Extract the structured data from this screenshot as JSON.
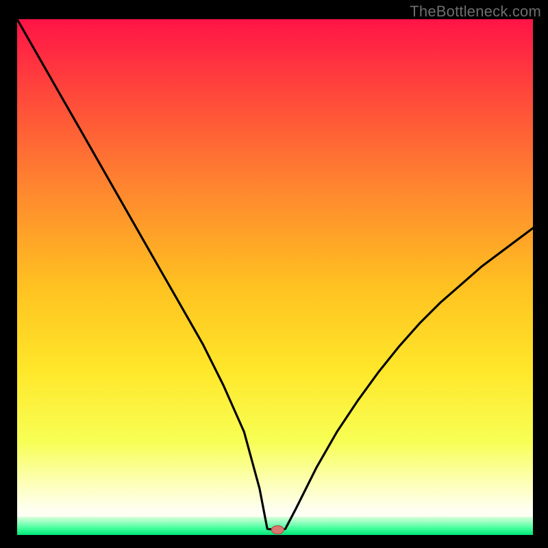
{
  "watermark": "TheBottleneck.com",
  "chart_data": {
    "type": "line",
    "title": "",
    "xlabel": "",
    "ylabel": "",
    "xlim": [
      0,
      100
    ],
    "ylim": [
      0,
      100
    ],
    "grid": false,
    "legend": false,
    "series": [
      {
        "name": "bottleneck-curve",
        "x": [
          0,
          4,
          8,
          12,
          16,
          20,
          24,
          28,
          32,
          36,
          40,
          44,
          47,
          48.5,
          50,
          51,
          52,
          54,
          58,
          62,
          66,
          70,
          74,
          78,
          82,
          86,
          90,
          94,
          98,
          100
        ],
        "values": [
          100,
          93,
          86,
          79,
          72,
          65,
          58,
          51,
          44,
          37,
          29,
          20,
          9,
          1.2,
          1.0,
          1.0,
          1.2,
          5,
          13,
          20,
          26,
          31.5,
          36.5,
          41,
          45,
          48.5,
          52,
          55,
          58,
          59.5
        ]
      }
    ],
    "minimum_marker": {
      "x": 50.5,
      "y": 1.0
    },
    "green_band_top_y": 3.5,
    "colors": {
      "gradient": [
        "#ff1447",
        "#ff7a2a",
        "#ffd21e",
        "#f9ff4a",
        "#ffffb0",
        "#fbffd1",
        "#7fffb5",
        "#00f27a"
      ],
      "curve": "#000000",
      "marker": "#d87a72",
      "background": "#000000",
      "watermark": "#6e6e6e"
    }
  }
}
